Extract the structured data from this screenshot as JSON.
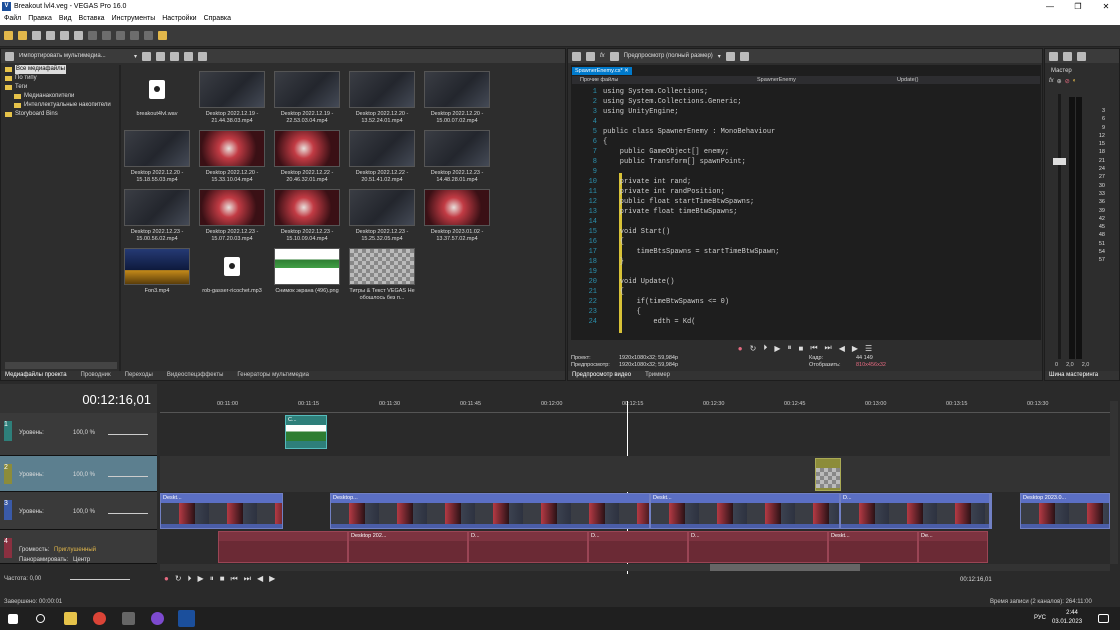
{
  "window": {
    "title": "Breakout lvl4.veg - VEGAS Pro 16.0",
    "controls": [
      "—",
      "❐",
      "✕"
    ]
  },
  "menu": [
    "Файл",
    "Правка",
    "Вид",
    "Вставка",
    "Инструменты",
    "Настройки",
    "Справка"
  ],
  "explorer": {
    "dropdown": "Импортировать мультимедиа...",
    "tree": [
      {
        "label": "Все медиафайлы",
        "selected": true
      },
      {
        "label": "По типу"
      },
      {
        "label": "Теги"
      },
      {
        "label": "Медианакопители"
      },
      {
        "label": "Интеллектуальные накопители"
      },
      {
        "label": "Storyboard Bins"
      }
    ],
    "media": [
      {
        "name": "breakout4lvl.wav",
        "kind": "audio"
      },
      {
        "name": "Desktop 2022.12.19 - 21.44.38.03.mp4",
        "kind": "dark"
      },
      {
        "name": "Desktop 2022.12.19 - 22.53.03.04.mp4",
        "kind": "dark"
      },
      {
        "name": "Desktop 2022.12.20 - 13.52.24.01.mp4",
        "kind": "dark"
      },
      {
        "name": "Desktop 2022.12.20 - 15.00.07.02.mp4",
        "kind": "dark"
      },
      {
        "name": "Desktop 2022.12.20 - 15.18.55.03.mp4",
        "kind": "dark"
      },
      {
        "name": "Desktop 2022.12.20 - 15.33.10.04.mp4",
        "kind": "red"
      },
      {
        "name": "Desktop 2022.12.22 - 20.46.32.01.mp4",
        "kind": "red"
      },
      {
        "name": "Desktop 2022.12.22 - 20.51.41.02.mp4",
        "kind": "dark"
      },
      {
        "name": "Desktop 2022.12.23 - 14.48.28.01.mp4",
        "kind": "dark"
      },
      {
        "name": "Desktop 2022.12.23 - 15.00.56.02.mp4",
        "kind": "dark"
      },
      {
        "name": "Desktop 2022.12.23 - 15.07.20.03.mp4",
        "kind": "red"
      },
      {
        "name": "Desktop 2022.12.23 - 15.10.09.04.mp4",
        "kind": "red"
      },
      {
        "name": "Desktop 2022.12.23 - 15.25.32.05.mp4",
        "kind": "dark"
      },
      {
        "name": "Desktop 2023.01.02 - 13.37.57.02.mp4",
        "kind": "red"
      },
      {
        "name": "Fon3.mp4",
        "kind": "game"
      },
      {
        "name": "rob-gasser-ricochet.mp3",
        "kind": "audio"
      },
      {
        "name": "Снимок экрана (496).png",
        "kind": "web"
      },
      {
        "name": "Титры & Текст VEGAS Не обошлось без п...",
        "kind": "check"
      }
    ],
    "tabs": [
      "Медиафайлы проекта",
      "Проводник",
      "Переходы",
      "Видеоспецэффекты",
      "Генераторы мультимедиа"
    ]
  },
  "preview": {
    "dropdown": "Предпросмотр (полный размер)",
    "code_tab": "SpawnerEnemy.cs*",
    "nav": [
      "Прочие файлы",
      "SpawnerEnemy",
      "Update()"
    ],
    "code": [
      {
        "n": "1",
        "t": "using System.Collections;"
      },
      {
        "n": "2",
        "t": "using System.Collections.Generic;"
      },
      {
        "n": "3",
        "t": "using UnityEngine;"
      },
      {
        "n": "4",
        "t": ""
      },
      {
        "n": "5",
        "t": "public class SpawnerEnemy : MonoBehaviour"
      },
      {
        "n": "6",
        "t": "{"
      },
      {
        "n": "7",
        "t": "    public GameObject[] enemy;"
      },
      {
        "n": "8",
        "t": "    public Transform[] spawnPoint;"
      },
      {
        "n": "9",
        "t": ""
      },
      {
        "n": "10",
        "t": "    private int rand;"
      },
      {
        "n": "11",
        "t": "    private int randPosition;"
      },
      {
        "n": "12",
        "t": "    public float startTimeBtwSpawns;"
      },
      {
        "n": "13",
        "t": "    private float timeBtwSpawns;"
      },
      {
        "n": "14",
        "t": ""
      },
      {
        "n": "15",
        "t": "    void Start()"
      },
      {
        "n": "16",
        "t": "    {"
      },
      {
        "n": "17",
        "t": "        timeBtsSpawns = startTimeBtwSpawn;"
      },
      {
        "n": "18",
        "t": "    }"
      },
      {
        "n": "19",
        "t": ""
      },
      {
        "n": "20",
        "t": "    void Update()"
      },
      {
        "n": "21",
        "t": "    {"
      },
      {
        "n": "22",
        "t": "        if(timeBtwSpawns <= 0)"
      },
      {
        "n": "23",
        "t": "        {"
      },
      {
        "n": "24",
        "t": "            edth = Kd("
      }
    ],
    "info": {
      "project_label": "Проект:",
      "project_value": "1920x1080x32; 59,984p",
      "preview_label": "Предпросмотр:",
      "preview_value": "1920x1080x32; 59,984p",
      "frame_label": "Кадр:",
      "frame_value": "44 149",
      "display_label": "Отобразить:",
      "display_value": "810x456x32"
    },
    "tabs": [
      "Предпросмотр видео",
      "Триммер"
    ]
  },
  "master": {
    "title": "Мастер",
    "ticks": [
      "3",
      "6",
      "9",
      "12",
      "15",
      "18",
      "21",
      "24",
      "27",
      "30",
      "33",
      "36",
      "39",
      "42",
      "45",
      "48",
      "51",
      "54",
      "57"
    ],
    "bottom": [
      "0",
      "2,0",
      "2,0"
    ],
    "tab": "Шина мастеринга"
  },
  "timeline": {
    "timecode": "00:12:16,01",
    "ruler": [
      "00:11:00",
      "00:11:15",
      "00:11:30",
      "00:11:45",
      "00:12:00",
      "00:12:15",
      "00:12:30",
      "00:12:45",
      "00:13:00",
      "00:13:15",
      "00:13:30"
    ],
    "tracks": [
      {
        "num": "1",
        "label": "Уровень:",
        "value": "100,0 %"
      },
      {
        "num": "2",
        "label": "Уровень:",
        "value": "100,0 %"
      },
      {
        "num": "3",
        "label": "Уровень:",
        "value": "100,0 %"
      },
      {
        "num": "4",
        "label": "Громкость:",
        "value": "Приглушенный",
        "label2": "Панорамировать:",
        "value2": "Центр"
      }
    ],
    "clips": {
      "video": [
        "Deskt...",
        "Desktop...",
        "Deskt...",
        "D...",
        "Desktop 2023.0..."
      ],
      "audio": [
        "Desktop 202...",
        "D...",
        "D...",
        "D...",
        "Deskt...",
        "De..."
      ],
      "small": "C..."
    },
    "rate_label": "Частота: 0,00",
    "cursor_time": "00:12:16,01"
  },
  "status": {
    "left": "Завершено: 00:00:01",
    "right": "Время записи (2 каналов): 264:11:00"
  },
  "taskbar": {
    "time": "2:44",
    "date": "03.01.2023",
    "lang": "РУС"
  },
  "colors": {
    "accent": "#3a6ea5",
    "video_clip": "#4a5da8",
    "audio_clip": "#6b2a35"
  }
}
